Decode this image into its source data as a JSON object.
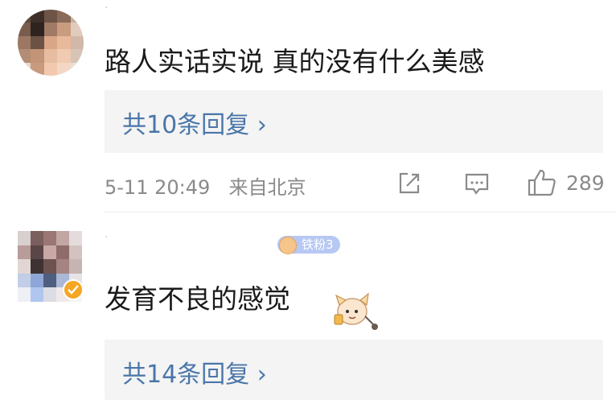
{
  "comments": [
    {
      "username": "·",
      "text": "路人实话实说 真的没有什么美感",
      "replies": "共10条回复 ›",
      "time": "5-11 20:49",
      "location": "来自北京",
      "likes": "289",
      "avatar_colors": [
        "#5b4a3e",
        "#3d2f28",
        "#6e5446",
        "#8a6a58",
        "#c8b0a0",
        "#7a5c4c",
        "#2d231f",
        "#a07a64",
        "#c99c80",
        "#e1cbbd",
        "#9c7864",
        "#6b5245",
        "#d9a788",
        "#e8b99a",
        "#d1b8a8",
        "#b38d76",
        "#c49478",
        "#e7bca0",
        "#f0cab1",
        "#d8c3b7",
        "#e8d6ca",
        "#c89a7e",
        "#f2c9ae",
        "#f3d7c4",
        "#e9ded6"
      ]
    },
    {
      "username": "·",
      "badge_text": "铁粉3",
      "text": "发育不良的感觉",
      "replies": "共14条回复 ›",
      "avatar_colors": [
        "#d8d0ce",
        "#7b5e5e",
        "#9a7674",
        "#c2a6a4",
        "#e4dcdc",
        "#b89c9a",
        "#5a4646",
        "#caa8a6",
        "#8e6c6c",
        "#d4c2c0",
        "#e2d6d4",
        "#3e3232",
        "#6e5252",
        "#a48482",
        "#c6b4b2",
        "#c2cde6",
        "#8ea6d8",
        "#4e5e7e",
        "#aab8d6",
        "#e6e4e6",
        "#eef0f6",
        "#b0c6ee",
        "#dcdde4",
        "#f0e8ea",
        "#f6f4f4"
      ]
    }
  ],
  "icons": {
    "repost": "share-box-icon",
    "comment": "comment-bubble-icon",
    "like": "thumbs-up-icon",
    "verified": "verified-badge-icon",
    "badge_heart": "fan-heart-icon",
    "sticker": "sticker-icon"
  }
}
